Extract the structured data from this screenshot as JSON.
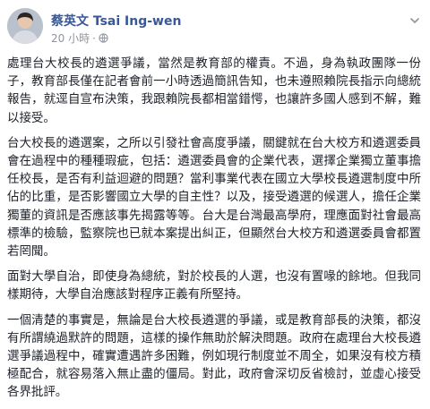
{
  "post": {
    "author": "蔡英文 Tsai Ing-wen",
    "timestamp": "20 小時",
    "separator": "·",
    "audience_icon": "globe-icon",
    "menu_icon": "chevron-down-icon",
    "link_color": "#385898",
    "paragraphs": [
      "處理台大校長的遴選爭議，當然是教育部的權責。不過，身為執政團隊一份子，教育部長僅在記者會前一小時透過簡訊告知，也未遵照賴院長指示向總統報告，就逕自宣布決策，我跟賴院長都相當錯愕，也讓許多國人感到不解，難以接受。",
      "台大校長的遴選案，之所以引發社會高度爭議，關鍵就在台大校方和遴選委員會在過程中的種種瑕疵，包括：遴選委員會的企業代表，選擇企業獨立董事擔任校長，是否有利益迴避的問題？當利事業代表在國立大學校長遴選制度中所佔的比重，是否影響國立大學的自主性？以及，接受遴選的候選人，擔任企業獨董的資訊是否應該事先揭露等等。台大是台灣最高學府，理應面對社會最高標準的檢驗，監察院也已就本案提出糾正，但顯然台大校方和遴選委員會都置若罔聞。",
      "面對大學自治，即使身為總統，對於校長的人選，也沒有置喙的餘地。但我同樣期待，大學自治應該對程序正義有所堅持。",
      "一個清楚的事實是，無論是台大校長遴選的爭議，或是教育部長的決策，都沒有所謂繞過默許的問題，這樣的操作無助於解決問題。政府在處理台大校長遴選爭議過程中，確實遭遇許多困難，例如現行制度並不周全，如果沒有校方積極配合，就容易落入無止盡的僵局。對此，政府會深切反省檢討，並虛心接受各界批評。"
    ]
  }
}
